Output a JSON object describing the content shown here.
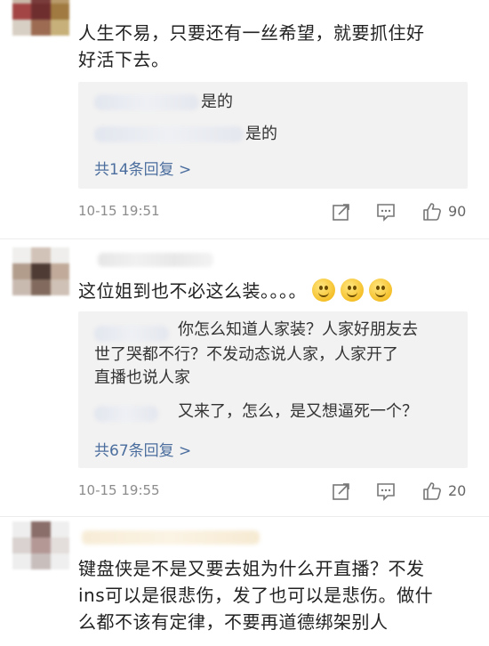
{
  "comments": [
    {
      "text_lines": [
        "人生不易，只要还有一丝希望，就要抓住好",
        "好活下去。"
      ],
      "replies": [
        {
          "text": "是的"
        },
        {
          "text": "是的"
        }
      ],
      "more_replies": "共14条回复 >",
      "timestamp": "10-15 19:51",
      "likes": "90"
    },
    {
      "text_lines": [
        "这位姐到也不必这么装。。。。"
      ],
      "emoji_count": 3,
      "replies": [
        {
          "lines": [
            "你怎么知道人家装？人家好朋友去",
            "世了哭都不行？不发动态说人家，人家开了",
            "直播也说人家"
          ]
        },
        {
          "lines": [
            "又来了，怎么，是又想逼死一个？"
          ]
        }
      ],
      "more_replies": "共67条回复 >",
      "timestamp": "10-15 19:55",
      "likes": "20"
    },
    {
      "text_lines": [
        "键盘侠是不是又要去姐为什么开直播？不发",
        "ins可以是很悲伤，发了也可以是悲伤。做什",
        "么都不该有定律，不要再道德绑架别人"
      ]
    }
  ],
  "icons": {
    "repost": "repost-icon",
    "comment": "comment-icon",
    "like": "thumbs-up-icon"
  },
  "colors": {
    "link": "#4b6e9e",
    "reply_bg": "#f2f2f2",
    "meta": "#8c8c8c"
  }
}
